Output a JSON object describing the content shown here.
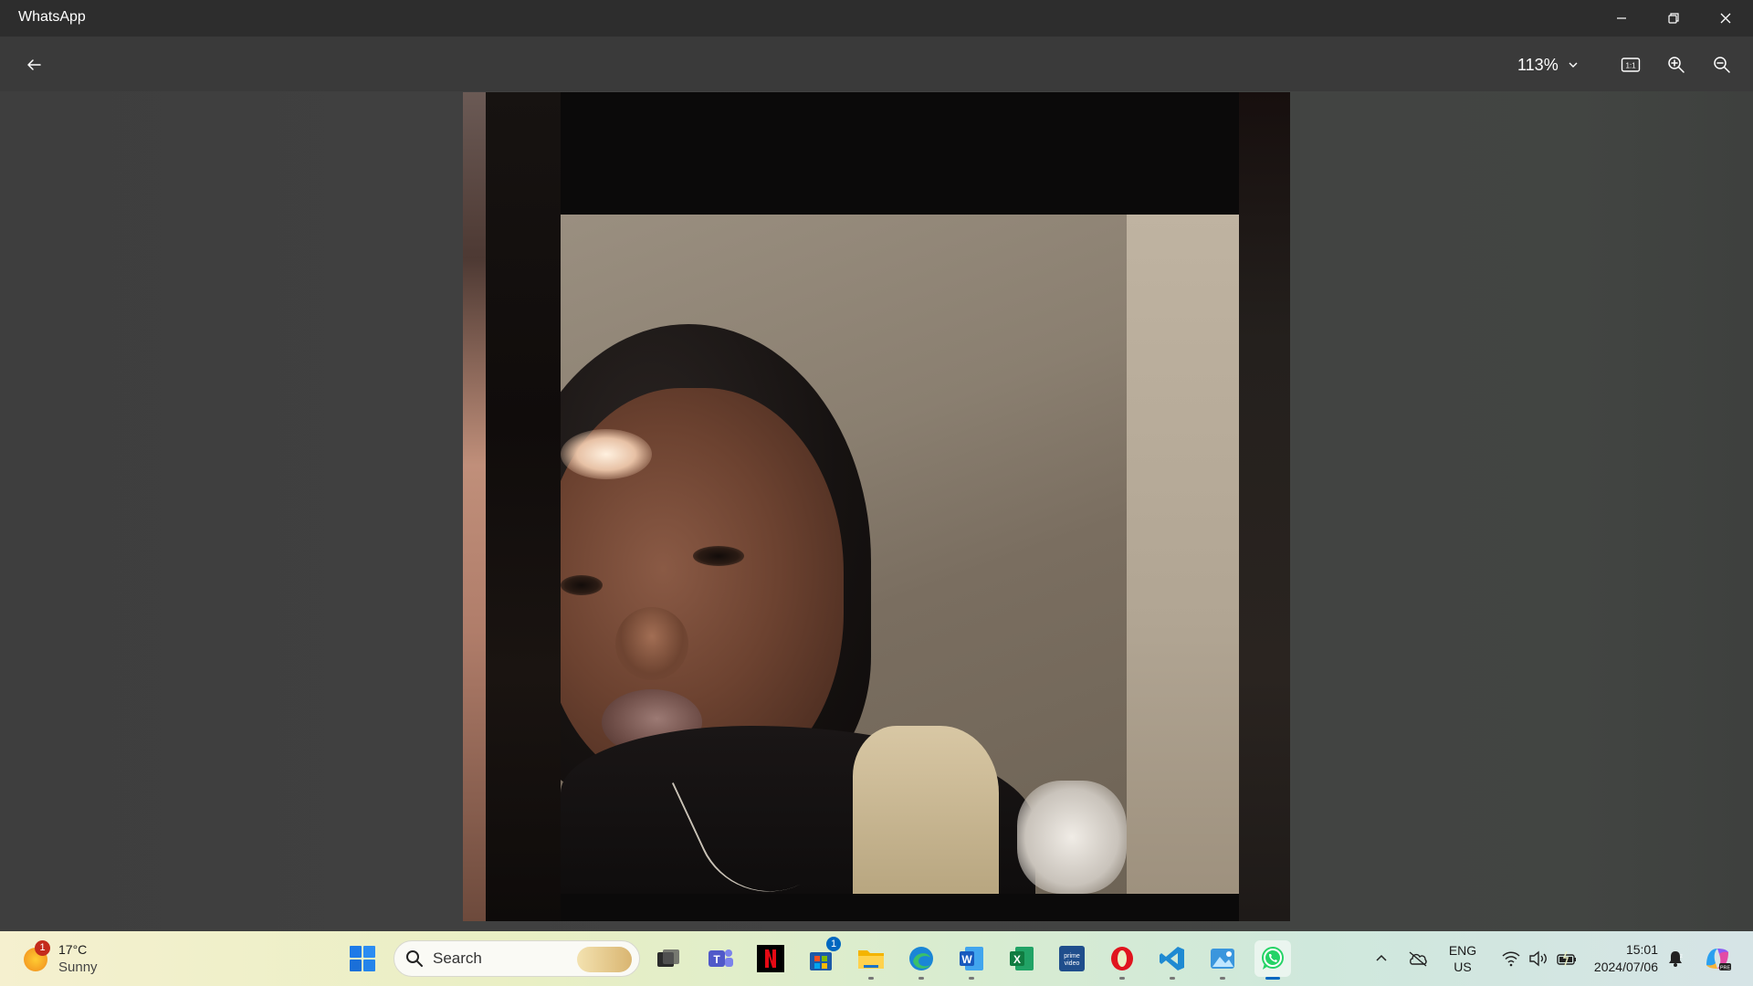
{
  "window": {
    "title": "WhatsApp"
  },
  "viewer": {
    "zoom_label": "113%"
  },
  "taskbar": {
    "weather": {
      "temperature": "17°C",
      "condition": "Sunny",
      "badge": "1"
    },
    "search_placeholder": "Search",
    "store_badge": "1",
    "pinned_apps": [
      "start",
      "search",
      "task-view",
      "teams",
      "netflix",
      "microsoft-store",
      "file-explorer",
      "edge",
      "word",
      "excel",
      "prime-video",
      "opera",
      "vscode",
      "photos",
      "whatsapp"
    ],
    "active_app": "whatsapp",
    "language": {
      "line1": "ENG",
      "line2": "US"
    },
    "clock": {
      "time": "15:01",
      "date": "2024/07/06"
    }
  },
  "colors": {
    "titlebar": "#2d2d2d",
    "toolbar": "#3a3a3a",
    "viewer_bg": "#424242",
    "accent": "#0067c0",
    "notification_red": "#c42b1c"
  }
}
